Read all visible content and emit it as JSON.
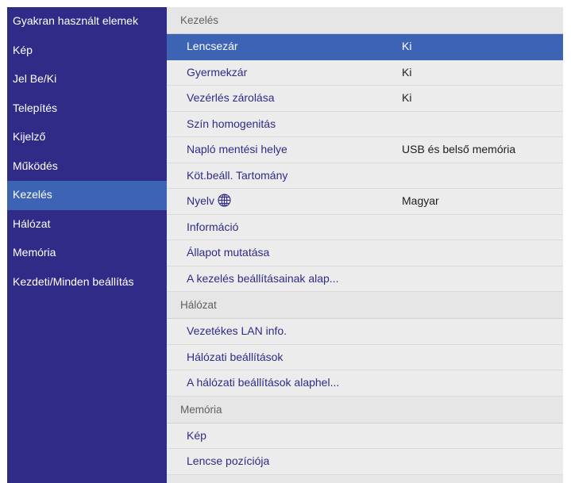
{
  "sidebar": {
    "items": [
      {
        "label": "Gyakran használt elemek",
        "active": false
      },
      {
        "label": "Kép",
        "active": false
      },
      {
        "label": "Jel Be/Ki",
        "active": false
      },
      {
        "label": "Telepítés",
        "active": false
      },
      {
        "label": "Kijelző",
        "active": false
      },
      {
        "label": "Működés",
        "active": false
      },
      {
        "label": "Kezelés",
        "active": true
      },
      {
        "label": "Hálózat",
        "active": false
      },
      {
        "label": "Memória",
        "active": false
      },
      {
        "label": "Kezdeti/Minden beállítás",
        "active": false
      }
    ]
  },
  "main": {
    "sections": [
      {
        "title": "Kezelés",
        "rows": [
          {
            "label": "Lencsezár",
            "value": "Ki",
            "selected": true
          },
          {
            "label": "Gyermekzár",
            "value": "Ki"
          },
          {
            "label": "Vezérlés zárolása",
            "value": "Ki"
          },
          {
            "label": "Szín homogenitás",
            "value": ""
          },
          {
            "label": "Napló mentési helye",
            "value": "USB és belső memória"
          },
          {
            "label": "Köt.beáll. Tartomány",
            "value": ""
          },
          {
            "label": "Nyelv",
            "value": "Magyar",
            "icon": "globe-icon"
          },
          {
            "label": "Információ",
            "value": ""
          },
          {
            "label": "Állapot mutatása",
            "value": ""
          },
          {
            "label": "A kezelés beállításainak alap...",
            "value": ""
          }
        ]
      },
      {
        "title": "Hálózat",
        "rows": [
          {
            "label": "Vezetékes LAN info.",
            "value": ""
          },
          {
            "label": "Hálózati beállítások",
            "value": ""
          },
          {
            "label": "A hálózati beállítások alaphel...",
            "value": ""
          }
        ]
      },
      {
        "title": "Memória",
        "rows": [
          {
            "label": "Kép",
            "value": ""
          },
          {
            "label": "Lencse pozíciója",
            "value": ""
          }
        ]
      }
    ]
  },
  "colors": {
    "sidebar_bg": "#2f2b86",
    "highlight": "#3c63b4",
    "row_bg": "#ececec",
    "item_text": "#2f2b86"
  }
}
